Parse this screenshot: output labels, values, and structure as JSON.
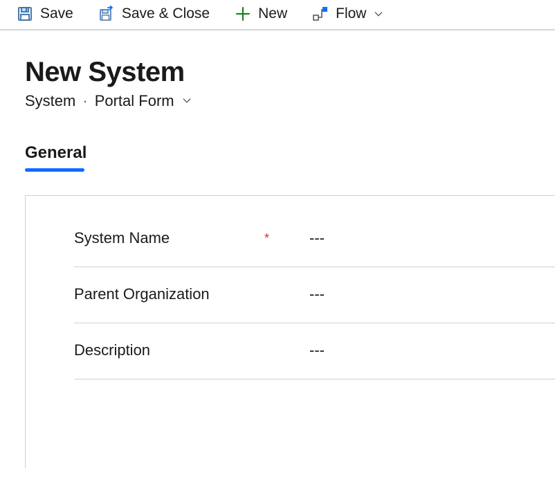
{
  "commandbar": {
    "save_label": "Save",
    "save_close_label": "Save & Close",
    "new_label": "New",
    "flow_label": "Flow"
  },
  "header": {
    "title": "New System",
    "entity": "System",
    "form_name": "Portal Form"
  },
  "tabs": [
    {
      "label": "General",
      "active": true
    }
  ],
  "fields": [
    {
      "label": "System Name",
      "required": true,
      "value": "---"
    },
    {
      "label": "Parent Organization",
      "required": false,
      "value": "---"
    },
    {
      "label": "Description",
      "required": false,
      "value": "---"
    }
  ],
  "symbols": {
    "asterisk": "*",
    "dot": "·"
  }
}
